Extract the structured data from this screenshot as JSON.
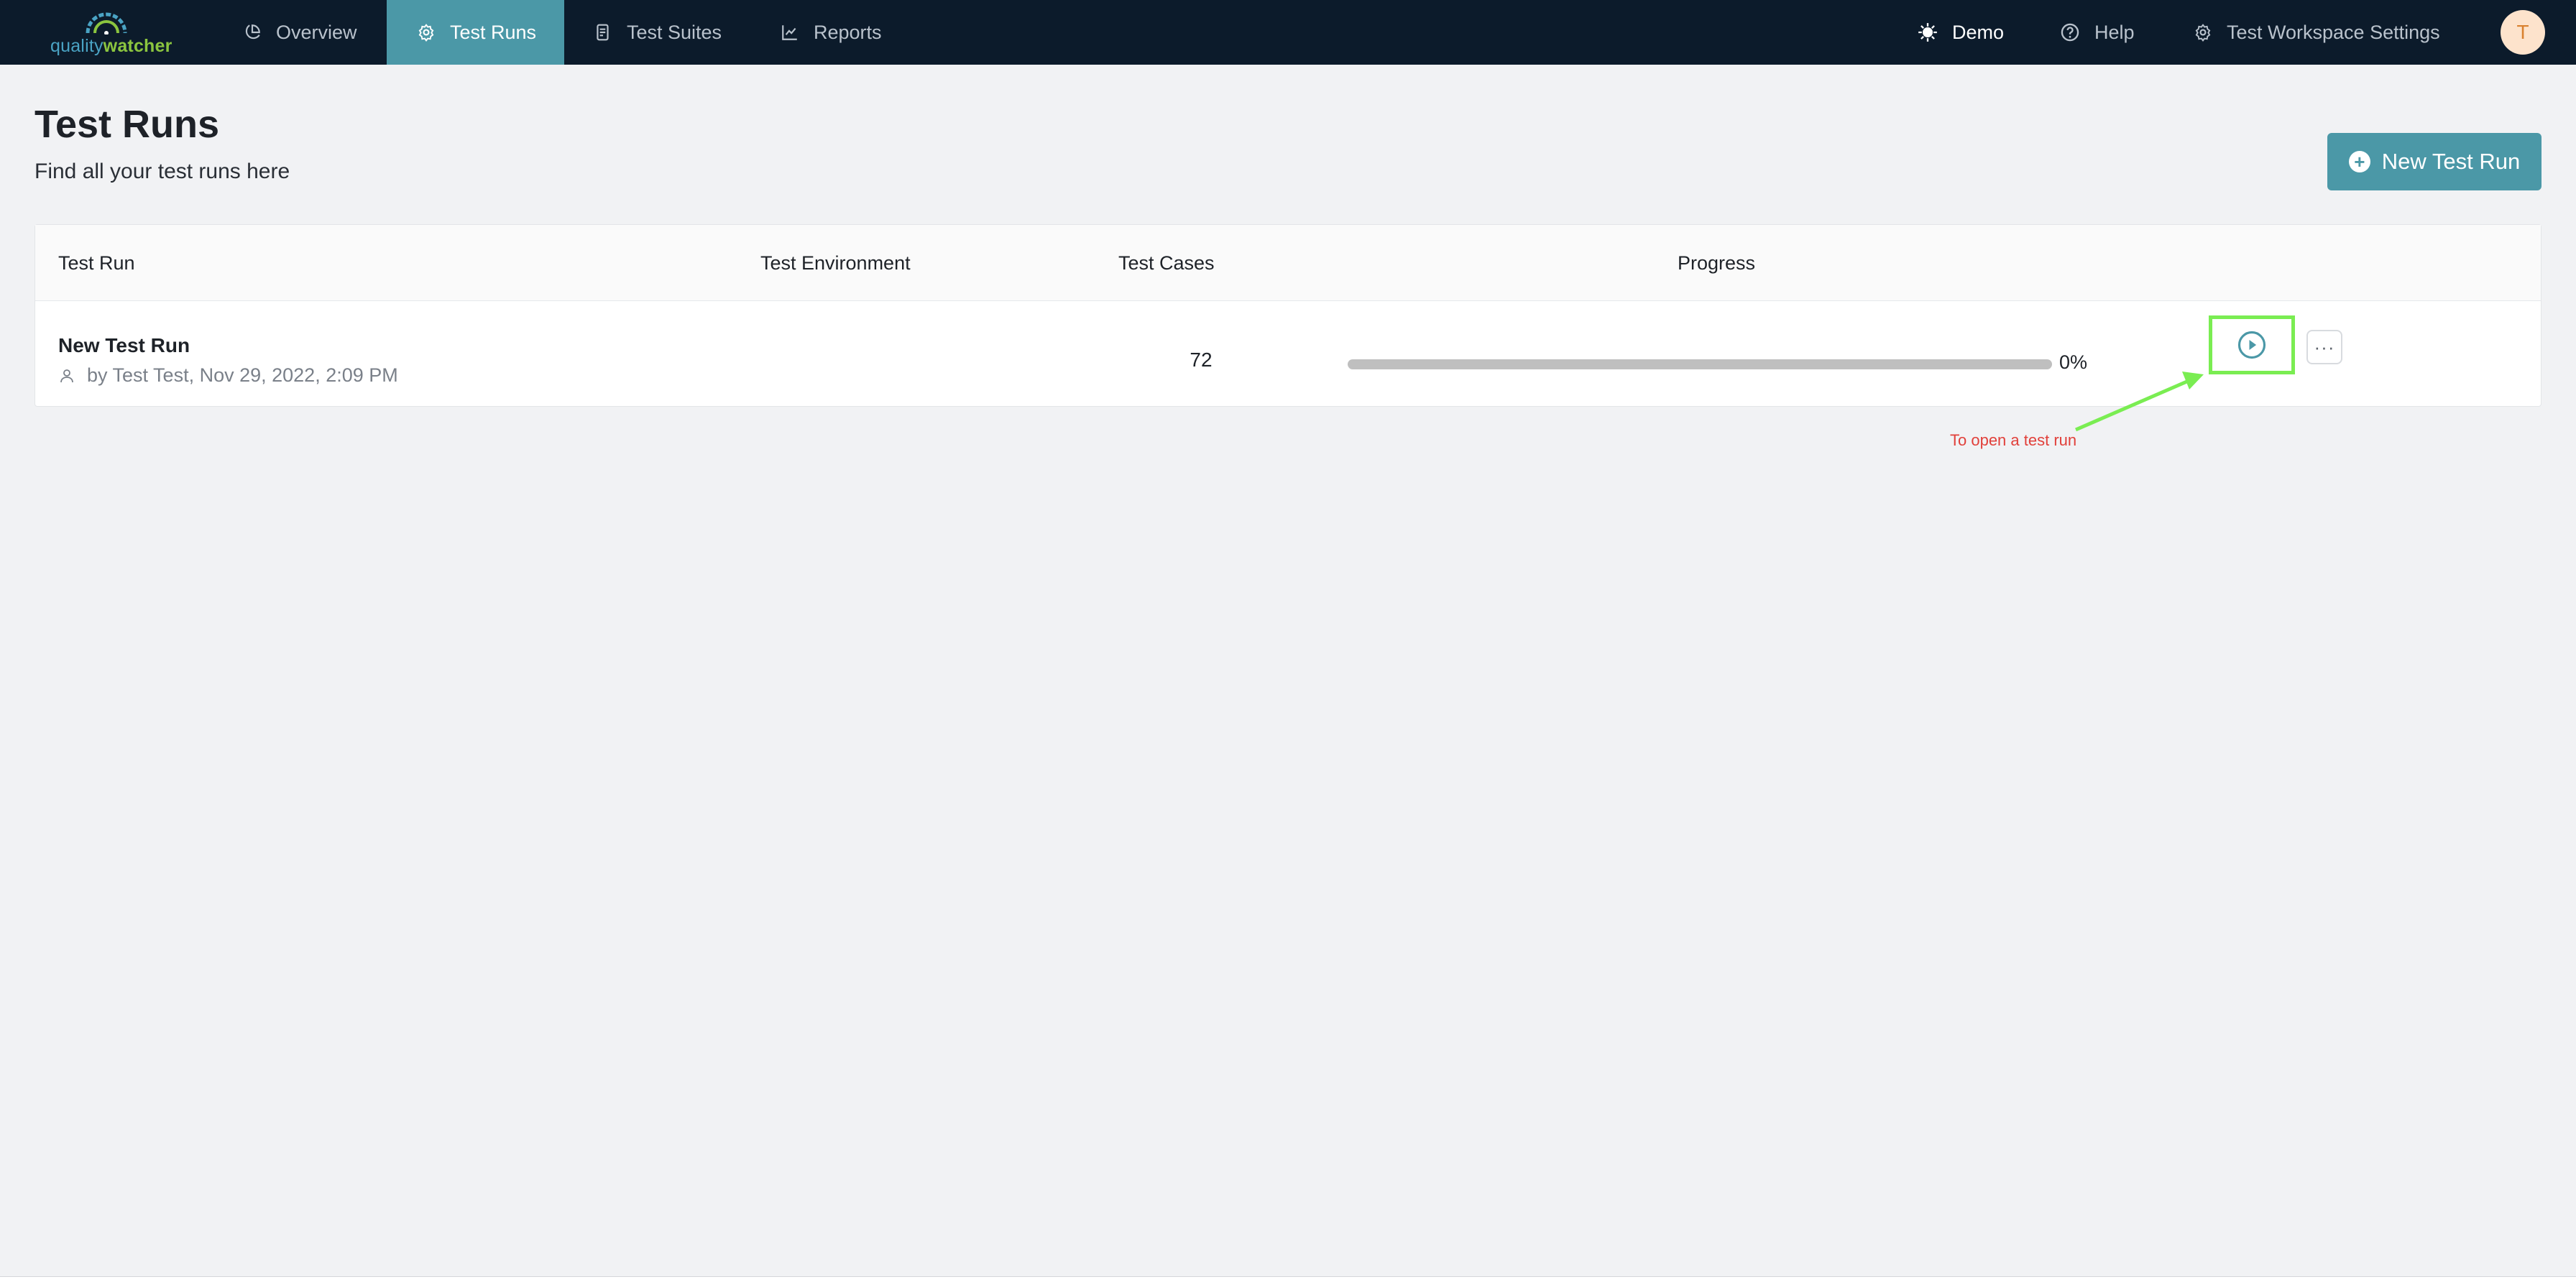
{
  "logo": {
    "part1": "quality",
    "part2": "watcher"
  },
  "nav": {
    "items": [
      {
        "label": "Overview",
        "icon": "pie-chart-icon"
      },
      {
        "label": "Test Runs",
        "icon": "gear-icon",
        "active": true
      },
      {
        "label": "Test Suites",
        "icon": "document-icon"
      },
      {
        "label": "Reports",
        "icon": "line-chart-icon"
      }
    ],
    "right": [
      {
        "label": "Demo",
        "icon": "sun-icon"
      },
      {
        "label": "Help",
        "icon": "help-icon"
      },
      {
        "label": "Test Workspace Settings",
        "icon": "gear-icon"
      }
    ],
    "avatar_initial": "T"
  },
  "page": {
    "title": "Test Runs",
    "subtitle": "Find all your test runs here",
    "new_button": "New Test Run"
  },
  "table": {
    "columns": [
      "Test Run",
      "Test Environment",
      "Test Cases",
      "Progress"
    ],
    "rows": [
      {
        "name": "New Test Run",
        "meta": "by Test Test, Nov 29, 2022, 2:09 PM",
        "environment": "",
        "cases": "72",
        "progress": 0,
        "progress_label": "0%",
        "more_label": "···"
      }
    ]
  },
  "annotation": {
    "text": "To open a test run",
    "color": "#e1403a",
    "highlight_color": "#7aed52"
  },
  "colors": {
    "topbar": "#0c1b2b",
    "accent": "#4b98a7",
    "background": "#f1f2f4"
  }
}
